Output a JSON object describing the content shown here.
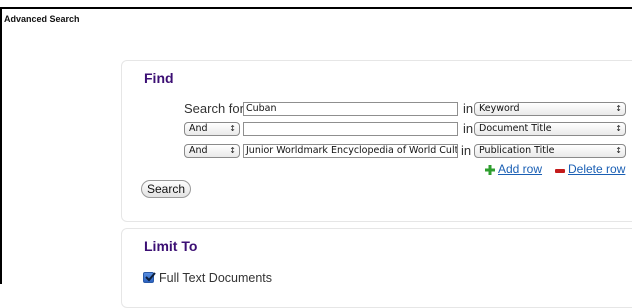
{
  "page": {
    "title": "Advanced Search"
  },
  "find": {
    "title": "Find",
    "search_for_label": "Search for",
    "in_label": "in",
    "rows": [
      {
        "operator": "",
        "value": "Cuban",
        "field": "Keyword"
      },
      {
        "operator": "And",
        "value": "",
        "field": "Document Title"
      },
      {
        "operator": "And",
        "value": "Junior Worldmark  Encyclopedia of World Cultu",
        "field": "Publication Title"
      }
    ],
    "add_row": "Add row",
    "delete_row": "Delete row",
    "search_button": "Search"
  },
  "limit": {
    "title": "Limit To",
    "full_text_label": "Full Text Documents",
    "full_text_checked": true
  },
  "colors": {
    "accent_title": "#3c0f74",
    "link": "#1a5fb4",
    "add_icon": "#2e9e2e",
    "delete_icon": "#c41b1b"
  }
}
